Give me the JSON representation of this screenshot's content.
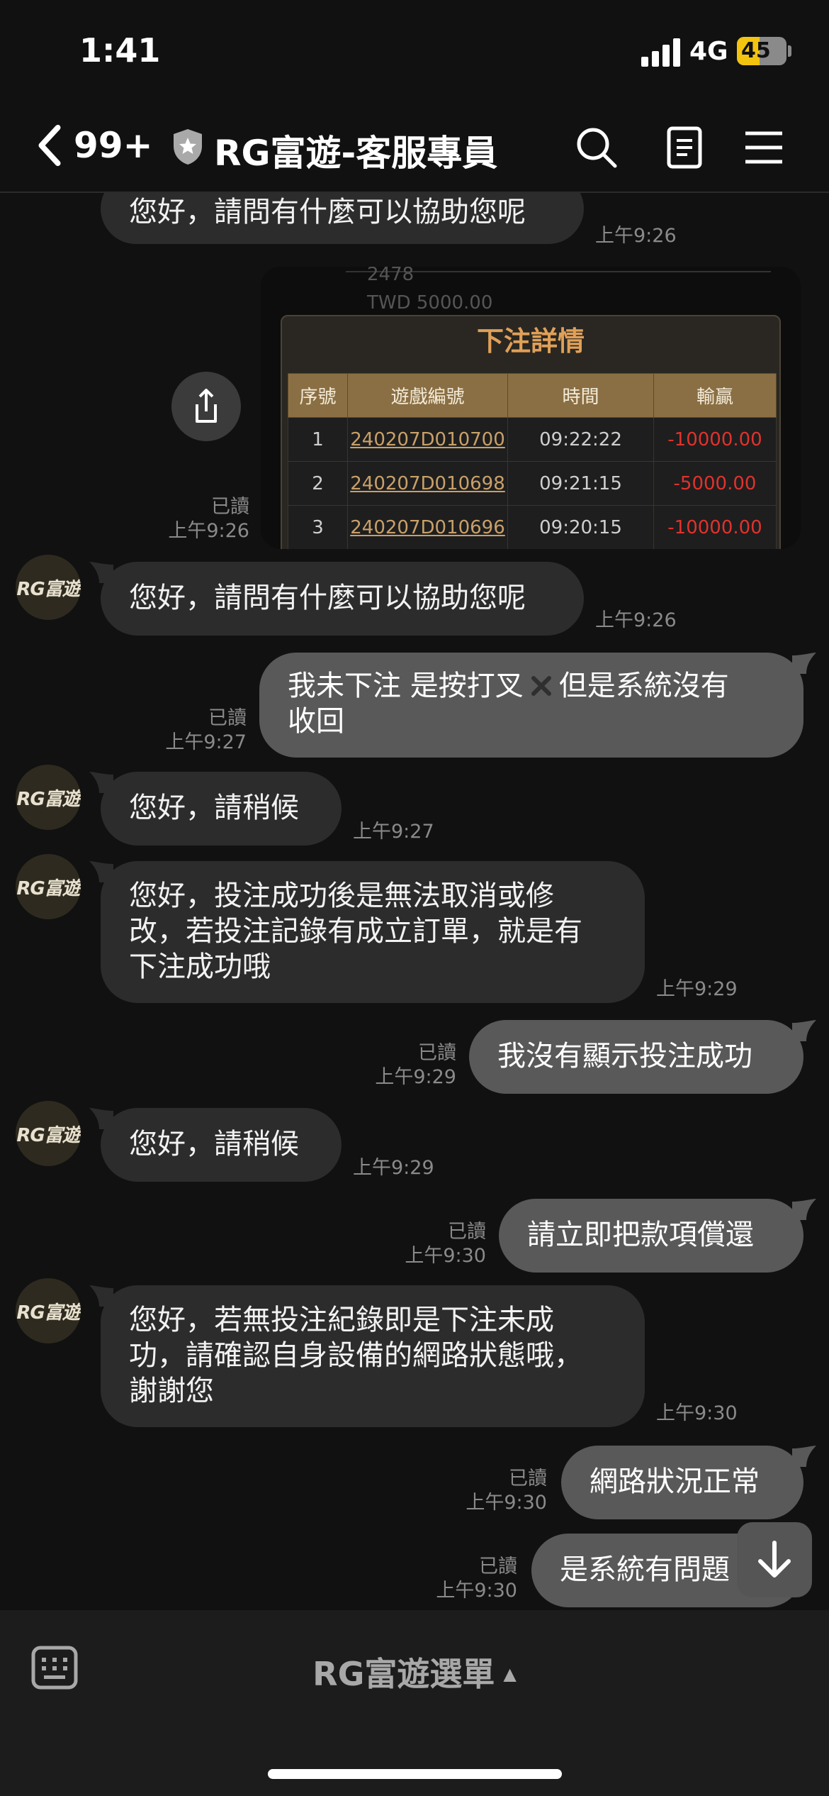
{
  "status_bar": {
    "time": "1:41",
    "network": "4G",
    "battery": "45",
    "battery_level": 0.45
  },
  "header": {
    "back_count": "99+",
    "title": "RG富遊-客服專員"
  },
  "avatar_text": "RG富遊",
  "messages": {
    "m0": {
      "text": "您好，請問有什麼可以協助您呢",
      "time": "上午9:26"
    },
    "image": {
      "read": "已讀",
      "time": "上午9:26",
      "bg_line1": "2478",
      "bg_line2": "TWD 5000.00",
      "panel_title": "下注詳情",
      "columns": [
        "序號",
        "遊戲編號",
        "時間",
        "輸贏"
      ],
      "rows": [
        [
          "1",
          "240207D010700",
          "09:22:22",
          "-10000.00"
        ],
        [
          "2",
          "240207D010698",
          "09:21:15",
          "-5000.00"
        ],
        [
          "3",
          "240207D010696",
          "09:20:15",
          "-10000.00"
        ]
      ]
    },
    "m1": {
      "text": "您好，請問有什麼可以協助您呢",
      "time": "上午9:26"
    },
    "m2": {
      "text_a": "我未下注 是按打叉",
      "text_b": "但是系統沒有\n收回",
      "read": "已讀",
      "time": "上午9:27"
    },
    "m3": {
      "text": "您好，請稍候",
      "time": "上午9:27"
    },
    "m4": {
      "text": "您好，投注成功後是無法取消或修\n改，若投注記錄有成立訂單，就是有\n下注成功哦",
      "time": "上午9:29"
    },
    "m5": {
      "text": "我沒有顯示投注成功",
      "read": "已讀",
      "time": "上午9:29"
    },
    "m6": {
      "text": "您好，請稍候",
      "time": "上午9:29"
    },
    "m7": {
      "text": "請立即把款項償還",
      "read": "已讀",
      "time": "上午9:30"
    },
    "m8": {
      "text": "您好，若無投注紀錄即是下注未成\n功，請確認自身設備的網路狀態哦，\n謝謝您",
      "time": "上午9:30"
    },
    "m9": {
      "text": "網路狀況正常",
      "read": "已讀",
      "time": "上午9:30"
    },
    "m10": {
      "text": "是系統有問題",
      "read": "已讀",
      "time": "上午9:30"
    }
  },
  "bottom": {
    "menu_label": "RG富遊選單",
    "menu_arrow": "▲"
  },
  "colors": {
    "incoming_bubble": "#2c2c2c",
    "outgoing_bubble": "#595959",
    "loss_red": "#e0322d",
    "panel_title": "#e0a058"
  }
}
